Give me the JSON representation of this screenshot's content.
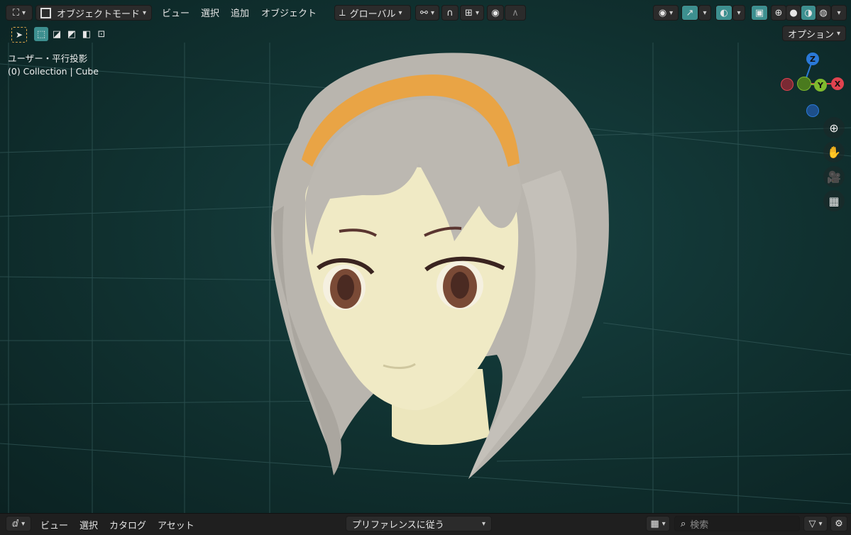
{
  "header": {
    "mode_label": "オブジェクトモード",
    "menus": [
      "ビュー",
      "選択",
      "追加",
      "オブジェクト"
    ],
    "transform_orientation": "グローバル",
    "options_label": "オプション"
  },
  "overlay": {
    "view_name": "ユーザー・平行投影",
    "collection_info": "(0) Collection | Cube"
  },
  "gizmo": {
    "z": "Z",
    "y": "Y",
    "x": "X",
    "colors": {
      "x": "#e0434f",
      "y": "#7fba2e",
      "z": "#2a79d8"
    }
  },
  "bottom": {
    "menus": [
      "ビュー",
      "選択",
      "カタログ",
      "アセット"
    ],
    "library_select": "プリファレンスに従う",
    "search_placeholder": "検索"
  },
  "icons": {
    "editor_type": "asset-browser-icon",
    "settings": "gear-icon",
    "filter": "funnel-icon"
  },
  "accent": "#3d9b9b"
}
